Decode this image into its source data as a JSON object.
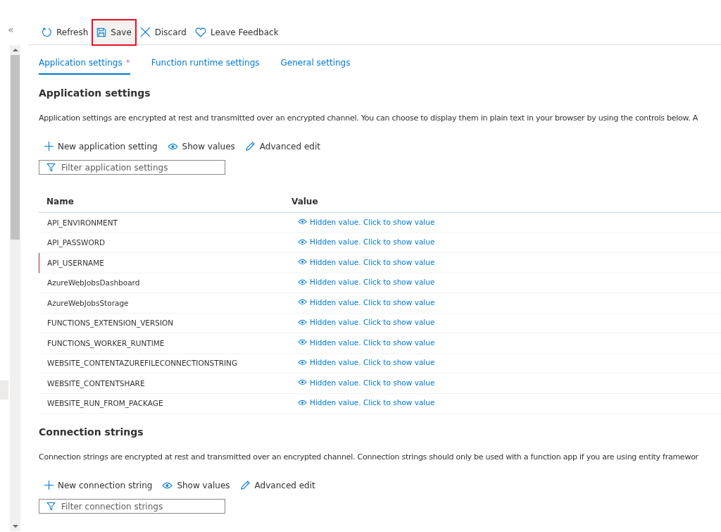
{
  "sidebar": {
    "collapse_glyph": "«"
  },
  "toolbar": [
    {
      "kind": "refresh",
      "label": "Refresh",
      "highlighted": false
    },
    {
      "kind": "save",
      "label": "Save",
      "highlighted": true
    },
    {
      "kind": "discard",
      "label": "Discard",
      "highlighted": false
    },
    {
      "kind": "feedback",
      "label": "Leave Feedback",
      "highlighted": false
    }
  ],
  "tabs": [
    {
      "label": "Application settings",
      "selected": true,
      "unsaved_mark": "*"
    },
    {
      "label": "Function runtime settings",
      "selected": false
    },
    {
      "label": "General settings",
      "selected": false
    }
  ],
  "sections": [
    {
      "title": "Application settings",
      "description": "Application settings are encrypted at rest and transmitted over an encrypted channel. You can choose to display them in plain text in your browser by using the controls below. A",
      "actions": [
        {
          "kind": "add",
          "label": "New application setting"
        },
        {
          "kind": "show",
          "label": "Show values"
        },
        {
          "kind": "edit",
          "label": "Advanced edit"
        }
      ],
      "filter": {
        "placeholder": "Filter application settings"
      },
      "table": {
        "columns": [
          "Name",
          "Value"
        ],
        "rows": [
          {
            "name": "API_ENVIRONMENT",
            "value": "Hidden value. Click to show value",
            "modified": false
          },
          {
            "name": "API_PASSWORD",
            "value": "Hidden value. Click to show value",
            "modified": false
          },
          {
            "name": "API_USERNAME",
            "value": "Hidden value. Click to show value",
            "modified": true
          },
          {
            "name": "AzureWebJobsDashboard",
            "value": "Hidden value. Click to show value",
            "modified": false
          },
          {
            "name": "AzureWebJobsStorage",
            "value": "Hidden value. Click to show value",
            "modified": false
          },
          {
            "name": "FUNCTIONS_EXTENSION_VERSION",
            "value": "Hidden value. Click to show value",
            "modified": false
          },
          {
            "name": "FUNCTIONS_WORKER_RUNTIME",
            "value": "Hidden value. Click to show value",
            "modified": false
          },
          {
            "name": "WEBSITE_CONTENTAZUREFILECONNECTIONSTRING",
            "value": "Hidden value. Click to show value",
            "modified": false
          },
          {
            "name": "WEBSITE_CONTENTSHARE",
            "value": "Hidden value. Click to show value",
            "modified": false
          },
          {
            "name": "WEBSITE_RUN_FROM_PACKAGE",
            "value": "Hidden value. Click to show value",
            "modified": false
          }
        ]
      }
    },
    {
      "title": "Connection strings",
      "description": "Connection strings are encrypted at rest and transmitted over an encrypted channel. Connection strings should only be used with a function app if you are using entity framewor",
      "actions": [
        {
          "kind": "add",
          "label": "New connection string"
        },
        {
          "kind": "show",
          "label": "Show values"
        },
        {
          "kind": "edit",
          "label": "Advanced edit"
        }
      ],
      "filter": {
        "placeholder": "Filter connection strings"
      }
    }
  ]
}
